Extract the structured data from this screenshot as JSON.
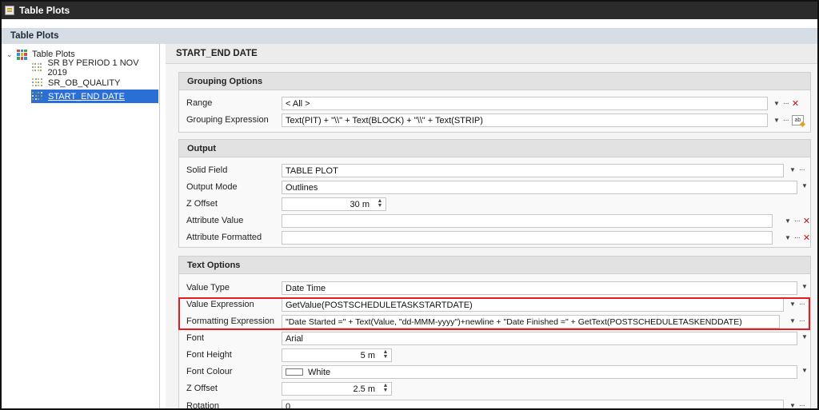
{
  "window": {
    "title": "Table Plots"
  },
  "panel": {
    "title": "Table Plots"
  },
  "tree": {
    "root_label": "Table Plots",
    "items": [
      {
        "label": "SR BY PERIOD 1 NOV 2019",
        "selected": false
      },
      {
        "label": "SR_OB_QUALITY",
        "selected": false
      },
      {
        "label": "START_END DATE",
        "selected": true
      }
    ]
  },
  "editor": {
    "title": "START_END DATE",
    "grouping": {
      "header": "Grouping Options",
      "range": {
        "label": "Range",
        "value": "< All >"
      },
      "grouping_expression": {
        "label": "Grouping Expression",
        "value": "Text(PIT) + \"\\\\\" + Text(BLOCK) + \"\\\\\" + Text(STRIP)"
      }
    },
    "output": {
      "header": "Output",
      "solid_field": {
        "label": "Solid Field",
        "value": "TABLE PLOT"
      },
      "output_mode": {
        "label": "Output Mode",
        "value": "Outlines"
      },
      "z_offset": {
        "label": "Z Offset",
        "value": "30 m"
      },
      "attribute_value": {
        "label": "Attribute Value",
        "value": ""
      },
      "attribute_formatted": {
        "label": "Attribute Formatted",
        "value": ""
      }
    },
    "text": {
      "header": "Text Options",
      "value_type": {
        "label": "Value Type",
        "value": "Date Time"
      },
      "value_expression": {
        "label": "Value Expression",
        "value": "GetValue(POSTSCHEDULETASKSTARTDATE)"
      },
      "formatting_expression": {
        "label": "Formatting Expression",
        "value": "\"Date Started =\" + Text(Value, \"dd-MMM-yyyy\")+newline + \"Date Finished =\" + GetText(POSTSCHEDULETASKENDDATE)"
      },
      "font": {
        "label": "Font",
        "value": "Arial"
      },
      "font_height": {
        "label": "Font Height",
        "value": "5 m"
      },
      "font_colour": {
        "label": "Font Colour",
        "value": "White"
      },
      "z_offset": {
        "label": "Z Offset",
        "value": "2.5 m"
      },
      "rotation": {
        "label": "Rotation",
        "value": "0"
      }
    }
  },
  "glyphs": {
    "dropdown": "▼",
    "ellipsis": "···",
    "clear": "✕",
    "spin_up": "▲",
    "spin_down": "▼",
    "tree_expand": "⌄",
    "expr_builder": "ab"
  },
  "colors": {
    "selection": "#2a6fd6",
    "highlight": "#e31b23",
    "clear": "#d0101b",
    "titlebar": "#2b2b2b"
  }
}
